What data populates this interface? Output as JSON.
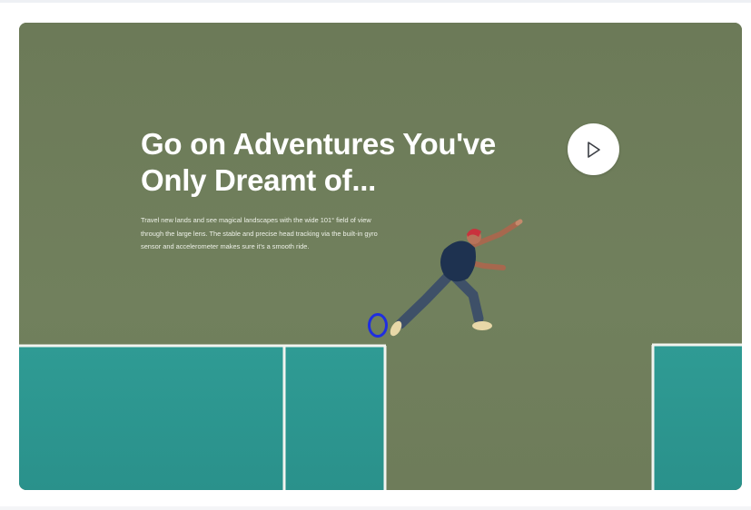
{
  "hero": {
    "headline_line1": "Go on Adventures You've",
    "headline_line2": "Only Dreamt of...",
    "description": "Travel new lands and see magical landscapes with the wide 101° field of view through the large lens. The stable and precise head tracking via the built-in gyro sensor and accelerometer makes sure it's a smooth ride.",
    "play_icon": "play-icon",
    "colors": {
      "ground": "#6f7d5c",
      "court": "#2f9a93",
      "court_line": "#f2f4f0",
      "text": "#ffffff",
      "play_button": "#ffffff",
      "cursor_marker": "#1f2ee0"
    }
  }
}
